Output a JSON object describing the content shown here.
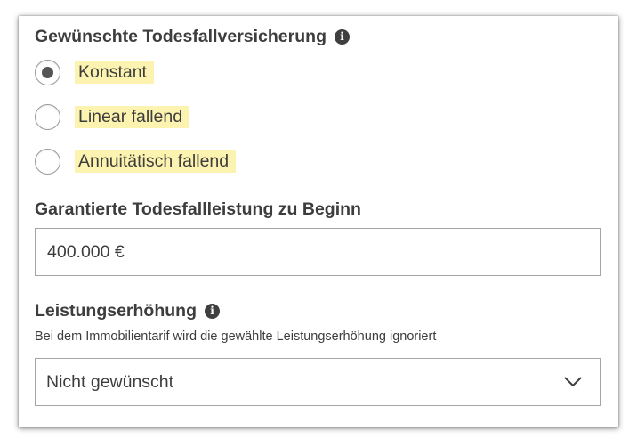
{
  "death_benefit": {
    "title": "Gewünschte Todesfallversicherung",
    "info_icon": "info-icon",
    "options": [
      {
        "label": "Konstant",
        "selected": true
      },
      {
        "label": "Linear fallend",
        "selected": false
      },
      {
        "label": "Annuitätisch fallend",
        "selected": false
      }
    ],
    "highlight_color": "#fdf3b0"
  },
  "guaranteed_benefit": {
    "title": "Garantierte Todesfallleistung zu Beginn",
    "value": "400.000 €"
  },
  "benefit_increase": {
    "title": "Leistungserhöhung",
    "info_icon": "info-icon",
    "hint": "Bei dem Immobilientarif wird die gewählte Leistungserhöhung ignoriert",
    "selected_value": "Nicht gewünscht",
    "dropdown_icon": "chevron-down-icon"
  }
}
